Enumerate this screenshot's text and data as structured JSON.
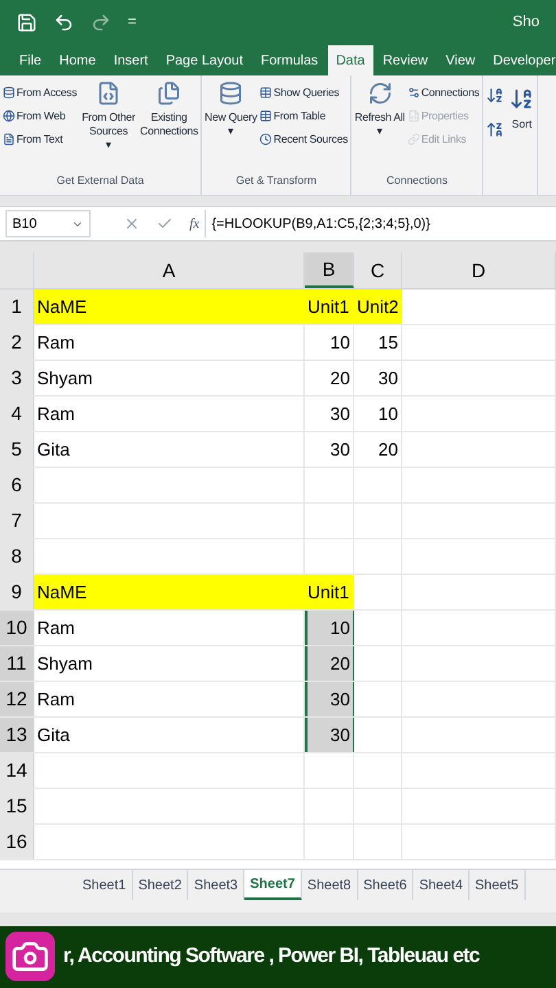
{
  "title_bar": {
    "quick_access": "=",
    "title": "Sho"
  },
  "ribbon_tabs": [
    {
      "label": "File",
      "selected": false
    },
    {
      "label": "Home",
      "selected": false
    },
    {
      "label": "Insert",
      "selected": false
    },
    {
      "label": "Page Layout",
      "selected": false
    },
    {
      "label": "Formulas",
      "selected": false
    },
    {
      "label": "Data",
      "selected": true
    },
    {
      "label": "Review",
      "selected": false
    },
    {
      "label": "View",
      "selected": false
    },
    {
      "label": "Developer",
      "selected": false
    }
  ],
  "ribbon_groups": [
    {
      "label": "Get External Data",
      "items": [
        {
          "kind": "stack",
          "entries": [
            {
              "label": "From Access",
              "disabled": false
            },
            {
              "label": "From Web",
              "disabled": false
            },
            {
              "label": "From Text",
              "disabled": false
            }
          ]
        },
        {
          "kind": "large",
          "label": "From Other Sources",
          "dropdown": "▾"
        },
        {
          "kind": "large",
          "label": "Existing Connections"
        }
      ]
    },
    {
      "label": "Get & Transform",
      "items": [
        {
          "kind": "large",
          "label": "New Query",
          "dropdown": "▾"
        },
        {
          "kind": "stack",
          "entries": [
            {
              "label": "Show Queries",
              "disabled": false
            },
            {
              "label": "From Table",
              "disabled": false
            },
            {
              "label": "Recent Sources",
              "disabled": false
            }
          ]
        }
      ]
    },
    {
      "label": "Connections",
      "items": [
        {
          "kind": "large",
          "label": "Refresh All",
          "dropdown": "▾"
        },
        {
          "kind": "stack",
          "entries": [
            {
              "label": "Connections",
              "disabled": false
            },
            {
              "label": "Properties",
              "disabled": true
            },
            {
              "label": "Edit Links",
              "disabled": true
            }
          ]
        }
      ]
    },
    {
      "items": [
        {
          "kind": "sort",
          "label": "Sort"
        }
      ]
    }
  ],
  "name_box": "B10",
  "function_label": "fx",
  "formula": "{=HLOOKUP(B9,A1:C5,{2;3;4;5},0)}",
  "columns": [
    {
      "label": "A",
      "selected": false
    },
    {
      "label": "B",
      "selected": true
    },
    {
      "label": "C",
      "selected": false
    },
    {
      "label": "D",
      "selected": false
    }
  ],
  "rows": [
    {
      "number": "1",
      "selected": false,
      "cells": [
        {
          "text": "NaME",
          "kind": "text",
          "highlighted": true
        },
        {
          "text": "Unit1",
          "kind": "text",
          "highlighted": true
        },
        {
          "text": "Unit2",
          "kind": "text",
          "highlighted": true
        },
        {}
      ]
    },
    {
      "number": "2",
      "selected": false,
      "cells": [
        {
          "text": "Ram",
          "kind": "text"
        },
        {
          "text": "10",
          "kind": "number"
        },
        {
          "text": "15",
          "kind": "number"
        },
        {}
      ]
    },
    {
      "number": "3",
      "selected": false,
      "cells": [
        {
          "text": "Shyam",
          "kind": "text"
        },
        {
          "text": "20",
          "kind": "number"
        },
        {
          "text": "30",
          "kind": "number"
        },
        {}
      ]
    },
    {
      "number": "4",
      "selected": false,
      "cells": [
        {
          "text": "Ram",
          "kind": "text"
        },
        {
          "text": "30",
          "kind": "number"
        },
        {
          "text": "10",
          "kind": "number"
        },
        {}
      ]
    },
    {
      "number": "5",
      "selected": false,
      "cells": [
        {
          "text": "Gita",
          "kind": "text"
        },
        {
          "text": "30",
          "kind": "number"
        },
        {
          "text": "20",
          "kind": "number"
        },
        {}
      ]
    },
    {
      "number": "6",
      "selected": false,
      "cells": [
        {},
        {},
        {},
        {}
      ]
    },
    {
      "number": "7",
      "selected": false,
      "cells": [
        {},
        {},
        {},
        {}
      ]
    },
    {
      "number": "8",
      "selected": false,
      "cells": [
        {},
        {},
        {},
        {}
      ]
    },
    {
      "number": "9",
      "selected": false,
      "cells": [
        {
          "text": "NaME",
          "kind": "text",
          "highlighted": true
        },
        {
          "text": "Unit1",
          "kind": "text",
          "highlighted": true
        },
        {},
        {}
      ]
    },
    {
      "number": "10",
      "selected": true,
      "cells": [
        {
          "text": "Ram",
          "kind": "text"
        },
        {
          "text": "10",
          "kind": "number",
          "selected": true
        },
        {},
        {}
      ]
    },
    {
      "number": "11",
      "selected": true,
      "cells": [
        {
          "text": "Shyam",
          "kind": "text"
        },
        {
          "text": "20",
          "kind": "number",
          "selected": true
        },
        {},
        {}
      ]
    },
    {
      "number": "12",
      "selected": true,
      "cells": [
        {
          "text": "Ram",
          "kind": "text"
        },
        {
          "text": "30",
          "kind": "number",
          "selected": true
        },
        {},
        {}
      ]
    },
    {
      "number": "13",
      "selected": true,
      "cells": [
        {
          "text": "Gita",
          "kind": "text"
        },
        {
          "text": "30",
          "kind": "number",
          "selected": true
        },
        {},
        {}
      ]
    },
    {
      "number": "14",
      "selected": false,
      "cells": [
        {},
        {},
        {},
        {}
      ]
    },
    {
      "number": "15",
      "selected": false,
      "cells": [
        {},
        {},
        {},
        {}
      ]
    },
    {
      "number": "16",
      "selected": false,
      "cells": [
        {},
        {},
        {},
        {}
      ]
    }
  ],
  "sheet_tabs": [
    {
      "label": "Sheet1",
      "selected": false
    },
    {
      "label": "Sheet2",
      "selected": false
    },
    {
      "label": "Sheet3",
      "selected": false
    },
    {
      "label": "Sheet7",
      "selected": true
    },
    {
      "label": "Sheet8",
      "selected": false
    },
    {
      "label": "Sheet6",
      "selected": false
    },
    {
      "label": "Sheet4",
      "selected": false
    },
    {
      "label": "Sheet5",
      "selected": false
    }
  ],
  "banner": "r, Accounting Software , Power BI, Tableuau etc"
}
